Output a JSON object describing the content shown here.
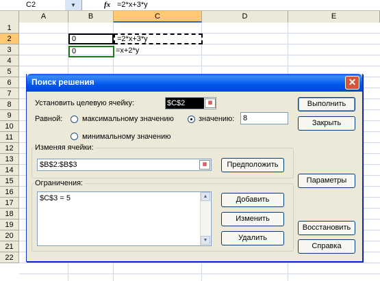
{
  "formula_bar": {
    "name_box": "C2",
    "fx_label": "fx",
    "formula": "=2*x+3*y"
  },
  "sheet": {
    "columns": [
      "A",
      "B",
      "C",
      "D",
      "E"
    ],
    "rows": [
      "1",
      "2",
      "3",
      "4",
      "5",
      "6",
      "7",
      "8",
      "9",
      "10",
      "11",
      "12",
      "13",
      "14",
      "15",
      "16",
      "17",
      "18",
      "19",
      "20",
      "21",
      "22"
    ],
    "cells": {
      "B2": "0",
      "C2": "=2*x+3*y",
      "B3": "0",
      "C3": "=x+2*y"
    }
  },
  "dialog": {
    "title": "Поиск решения",
    "target_label": "Установить целевую ячейку:",
    "target_value": "$C$2",
    "equal_label": "Равной:",
    "radio_max": "максимальному значению",
    "radio_value": "значению:",
    "value_input": "8",
    "radio_min": "минимальному значению",
    "changing_label": "Изменяя ячейки:",
    "changing_value": "$B$2:$B$3",
    "constraints_label": "Ограничения:",
    "constraints": [
      "$C$3 = 5"
    ],
    "buttons": {
      "solve": "Выполнить",
      "close": "Закрыть",
      "options": "Параметры",
      "reset": "Восстановить",
      "help": "Справка",
      "guess": "Предположить",
      "add": "Добавить",
      "change": "Изменить",
      "delete": "Удалить"
    },
    "selected_radio": "value"
  }
}
